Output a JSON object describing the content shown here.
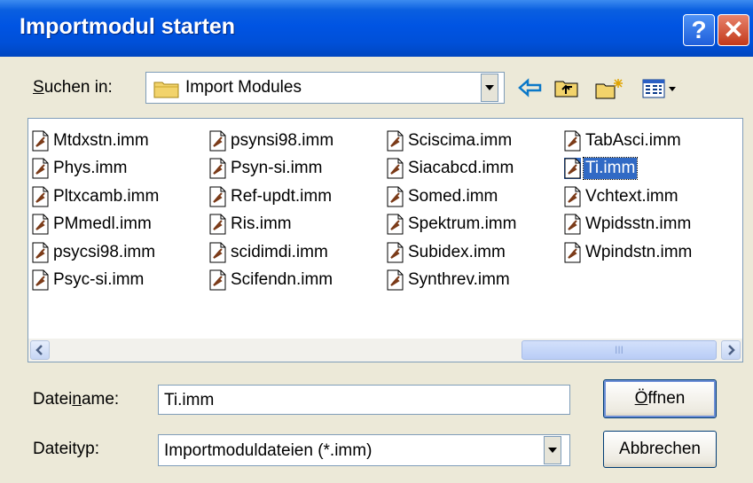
{
  "dialog": {
    "title": "Importmodul starten",
    "help_symbol": "?",
    "close_symbol": "✕"
  },
  "look_in": {
    "label_pre": "",
    "label_access": "S",
    "label_post": "uchen in:",
    "value": "Import Modules"
  },
  "toolbar": {
    "icons": [
      "back-arrow-icon",
      "up-folder-icon",
      "new-folder-icon",
      "view-menu-icon"
    ],
    "arrow_color": "#0a78c8"
  },
  "files": [
    [
      "Mtdxstn.imm",
      "Phys.imm",
      "Pltxcamb.imm",
      "PMmedl.imm",
      "psycsi98.imm",
      "Psyc-si.imm"
    ],
    [
      "psynsi98.imm",
      "Psyn-si.imm",
      "Ref-updt.imm",
      "Ris.imm",
      "scidimdi.imm",
      "Scifendn.imm"
    ],
    [
      "Sciscima.imm",
      "Siacabcd.imm",
      "Somed.imm",
      "Spektrum.imm",
      "Subidex.imm",
      "Synthrev.imm"
    ],
    [
      "TabAsci.imm",
      "Ti.imm",
      "Vchtext.imm",
      "Wpidsstn.imm",
      "Wpindstn.imm"
    ]
  ],
  "selected_file": "Ti.imm",
  "filename": {
    "label_pre": "Datei",
    "label_access": "n",
    "label_post": "ame:",
    "value": "Ti.imm"
  },
  "filetype": {
    "label": "Dateityp:",
    "value": "Importmoduldateien (*.imm)"
  },
  "buttons": {
    "open_access": "Ö",
    "open_rest": "ffnen",
    "cancel": "Abbrechen"
  },
  "scrollbar": {
    "left_arrow": "‹",
    "right_arrow": "›",
    "thumb_grip": "III"
  },
  "colors": {
    "titlebar": "#0054e3",
    "selection": "#316ac5",
    "dialog_bg": "#ece9d8"
  }
}
